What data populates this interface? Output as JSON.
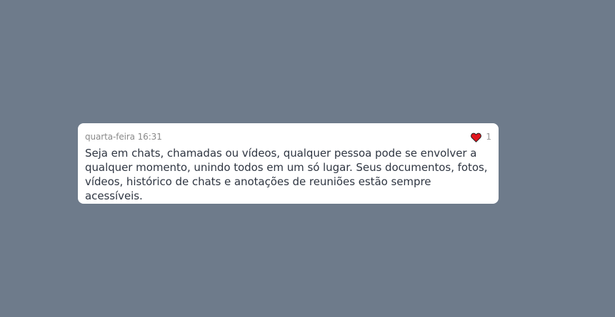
{
  "message": {
    "timestamp": "quarta-feira 16:31",
    "text": "Seja em chats, chamadas ou vídeos, qualquer pessoa pode se envolver a qualquer momento, unindo todos em um só lugar. Seus documentos, fotos, vídeos, histórico de chats e anotações de reuniões estão sempre acessíveis.",
    "reaction": {
      "icon": "heart-icon",
      "count": "1",
      "color": "#e0161e"
    }
  },
  "colors": {
    "background": "#6e7b8b",
    "card": "#ffffff",
    "text": "#2f3642",
    "muted": "#8a8a8a"
  }
}
